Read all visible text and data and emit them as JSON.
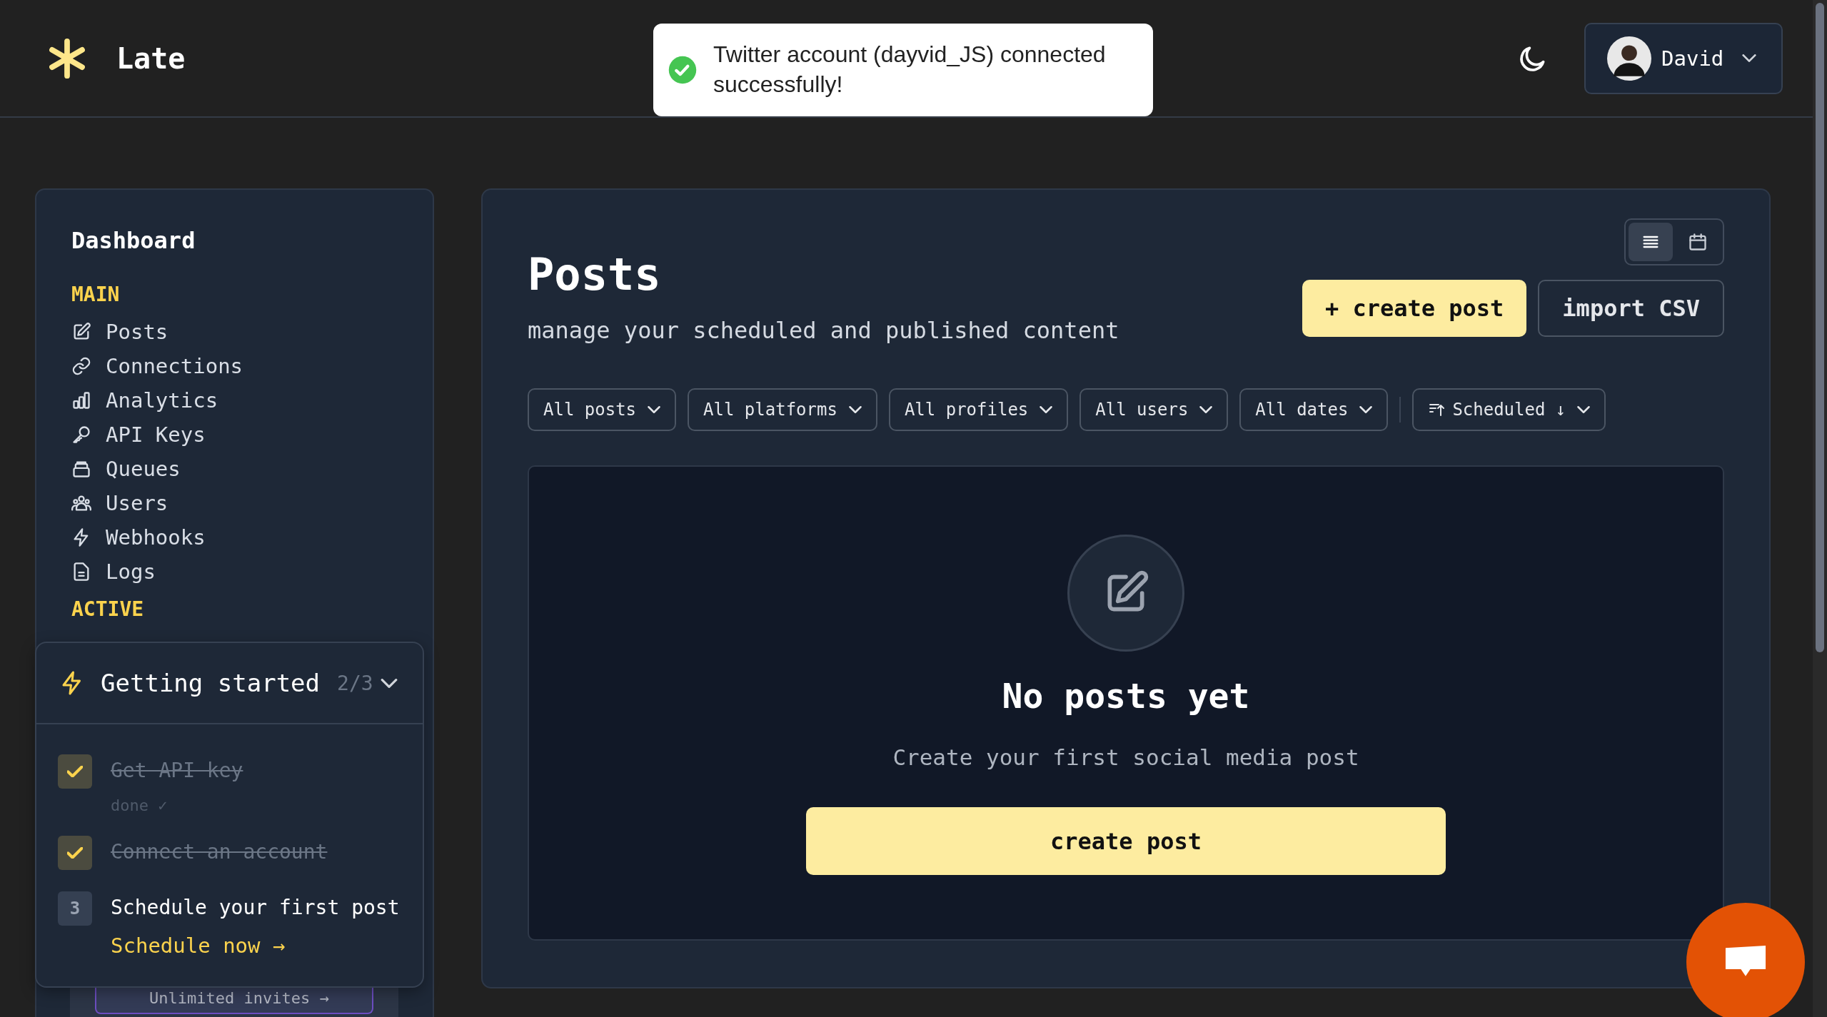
{
  "header": {
    "logo_text": "Late",
    "user": {
      "name": "David"
    }
  },
  "toast": {
    "message": "Twitter account (dayvid_JS) connected successfully!"
  },
  "sidebar": {
    "title": "Dashboard",
    "sections": [
      {
        "heading": "MAIN",
        "items": [
          {
            "label": "Posts"
          },
          {
            "label": "Connections"
          },
          {
            "label": "Analytics"
          },
          {
            "label": "API Keys"
          },
          {
            "label": "Queues"
          },
          {
            "label": "Users"
          },
          {
            "label": "Webhooks"
          },
          {
            "label": "Logs"
          }
        ]
      },
      {
        "heading": "ACTIVE"
      }
    ],
    "promo": {
      "label": "Unlimited invites →"
    }
  },
  "getting_started": {
    "title": "Getting started",
    "progress": "2/3",
    "expanded": true,
    "steps": [
      {
        "label": "Get API key",
        "done": true,
        "note": "done ✓"
      },
      {
        "label": "Connect an account",
        "done": true
      },
      {
        "label": "Schedule your first post",
        "done": false,
        "number": "3",
        "action": "Schedule now →"
      }
    ]
  },
  "posts": {
    "title": "Posts",
    "subtitle": "manage your scheduled and published content",
    "view_modes": [
      {
        "kind": "list",
        "selected": true
      },
      {
        "kind": "calendar",
        "selected": false
      }
    ],
    "actions": [
      {
        "label": "+ create post",
        "kind": "primary"
      },
      {
        "label": "import CSV",
        "kind": "secondary"
      }
    ],
    "filters": [
      {
        "label": "All posts"
      },
      {
        "label": "All platforms"
      },
      {
        "label": "All profiles"
      },
      {
        "label": "All users"
      },
      {
        "label": "All dates"
      }
    ],
    "sort": {
      "label": "Scheduled ↓"
    },
    "empty_state": {
      "title": "No posts yet",
      "message": "Create your first social media post",
      "button": "create post"
    }
  }
}
